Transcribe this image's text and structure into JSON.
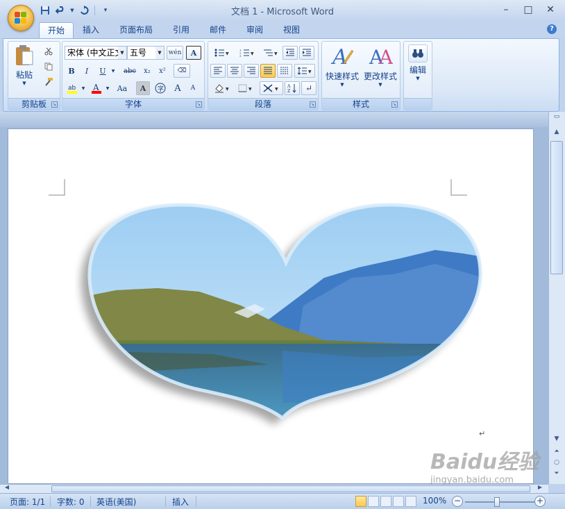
{
  "window": {
    "title": "文档 1 - Microsoft Word",
    "minimize_glyph": "–",
    "maximize_glyph": "□",
    "close_glyph": "✕"
  },
  "quick_access": [
    "save-icon",
    "undo-icon",
    "redo-icon",
    "customize-icon"
  ],
  "tabs": [
    {
      "label": "开始",
      "active": true
    },
    {
      "label": "插入"
    },
    {
      "label": "页面布局"
    },
    {
      "label": "引用"
    },
    {
      "label": "邮件"
    },
    {
      "label": "审阅"
    },
    {
      "label": "视图"
    }
  ],
  "help_glyph": "?",
  "ribbon": {
    "clipboard": {
      "label": "剪贴板",
      "paste_label": "粘贴"
    },
    "font": {
      "label": "字体",
      "font_name": "宋体 (中文正文)",
      "font_size": "五号",
      "bold": "B",
      "italic": "I",
      "underline": "U",
      "strike": "abc",
      "subscript": "x₂",
      "superscript": "x²",
      "grow": "A",
      "shrink": "A",
      "change_case": "Aa"
    },
    "paragraph": {
      "label": "段落"
    },
    "styles": {
      "label": "样式",
      "quick_styles": "快速样式",
      "change_styles": "更改样式"
    },
    "editing": {
      "label": "编辑",
      "button": "编辑"
    }
  },
  "document": {
    "image": "heart-shaped-lake-landscape",
    "paragraph_mark": "↵"
  },
  "status": {
    "page": "页面: 1/1",
    "words": "字数: 0",
    "language": "英语(美国)",
    "mode": "插入",
    "zoom": "100%",
    "zoom_level": 1.0
  },
  "watermark": {
    "brand": "Baidu经验",
    "url": "jingyan.baidu.com"
  },
  "colors": {
    "highlight": "#ffff00",
    "font_color": "#ff0000",
    "ribbon_text": "#15428b"
  }
}
